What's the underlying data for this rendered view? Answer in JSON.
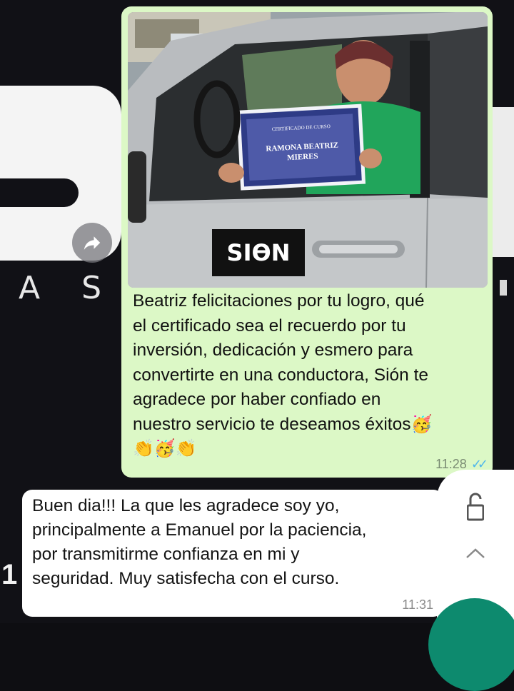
{
  "background": {
    "wallpaper_word": "A S E",
    "wallpaper_number": "1"
  },
  "outgoing_message": {
    "photo": {
      "description_icon": "car-certificate-photo",
      "certificate_heading": "CERTIFICADO DE CURSO",
      "certificate_name_line1": "RAMONA BEATRIZ",
      "certificate_name_line2": "MIERES",
      "car_logo": "SIϴN"
    },
    "caption_lines": [
      "Beatriz felicitaciones por tu logro, qué",
      "el certificado sea el recuerdo por tu",
      "inversión, dedicación y esmero para",
      "convertirte en una conductora, Sión te",
      "agradece por haber confiado en",
      "nuestro servicio te deseamos éxitos"
    ],
    "emojis_line": "👏🥳👏",
    "trailing_emoji": "🥳",
    "time": "11:28",
    "status_icon": "double-check-read"
  },
  "incoming_message": {
    "lines": [
      "Buen dia!!! La que les agradece soy yo,",
      "principalmente a Emanuel por la paciencia,",
      "por transmitirme confianza en mi y",
      "seguridad. Muy satisfecha con el curso."
    ],
    "time": "11:31"
  },
  "controls": {
    "lock_icon": "unlock-icon",
    "chevron_icon": "chevron-up-icon"
  },
  "colors": {
    "outgoing_bubble": "#dcf8c6",
    "incoming_bubble": "#ffffff",
    "read_ticks": "#4fb6ec",
    "fab": "#0d8a6e"
  }
}
